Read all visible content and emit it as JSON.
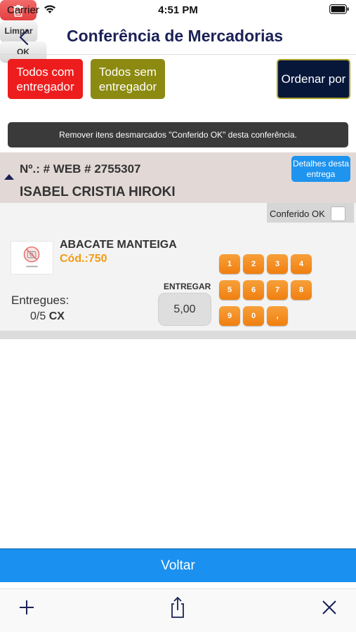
{
  "status_bar": {
    "carrier": "Carrier",
    "time": "4:51 PM"
  },
  "nav": {
    "title": "Conferência de Mercadorias"
  },
  "filters": {
    "todos_com_entregador": "Todos com entregador",
    "todos_sem_entregador": "Todos sem entregador",
    "ordenar_por": "Ordenar por"
  },
  "remove_bar": {
    "text": "Remover itens desmarcados \"Conferido OK\" desta conferência."
  },
  "delivery": {
    "order_number": "Nº.: # WEB # 2755307",
    "customer_name": "ISABEL CRISTIA HIROKI",
    "details_button": "Detalhes desta entrega"
  },
  "item": {
    "conferido_label": "Conferido OK",
    "conferido_checked": false,
    "product_name": "ABACATE MANTEIGA",
    "product_code": "Cód.:750",
    "entregues_label": "Entregues:",
    "entregues_count": "0/5",
    "entregues_unit": "CX",
    "entregar_label": "ENTREGAR",
    "entregar_value": "5,00"
  },
  "keypad": {
    "keys": [
      "1",
      "2",
      "3",
      "4",
      "5",
      "6",
      "7",
      "8",
      "9",
      "0",
      ","
    ],
    "limpar": "Limpar",
    "ok": "OK"
  },
  "footer": {
    "voltar": "Voltar"
  },
  "colors": {
    "accent_blue": "#1a90f0",
    "red_button": "#ee1d1d",
    "olive_button": "#8c8a10",
    "navy": "#07173a",
    "orange_key": "#f39a11"
  },
  "icons": {
    "back": "chevron-left-icon",
    "trash": "trash-icon",
    "add": "plus-icon",
    "share": "share-icon",
    "close": "close-icon"
  }
}
